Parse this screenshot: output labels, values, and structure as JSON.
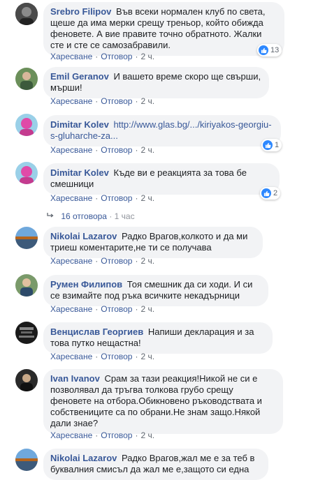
{
  "comments": [
    {
      "author": "Srebro Filipov",
      "text": "Във всеки нормален клуб по света, щеше да има мерки срещу треньор, който обижда феновете. А вие правите точно обратното. Жалки сте и сте се самозабравили.",
      "like_label": "Харесване",
      "reply_label": "Отговор",
      "time": "2 ч.",
      "reactions": "13"
    },
    {
      "author": "Emil Geranov",
      "text": "И вашето време скоро ще свърши, мърши!",
      "like_label": "Харесване",
      "reply_label": "Отговор",
      "time": "2 ч."
    },
    {
      "author": "Dimitar Kolev",
      "text": "http://www.glas.bg/.../kiriyakos-georgiu-s-gluharche-za...",
      "like_label": "Харесване",
      "reply_label": "Отговор",
      "time": "2 ч.",
      "reactions": "1"
    },
    {
      "author": "Dimitar Kolev",
      "text": "Къде ви е реакцията за това бе смешници",
      "like_label": "Харесване",
      "reply_label": "Отговор",
      "time": "2 ч.",
      "reactions": "2"
    },
    {
      "author": "Nikolai Lazarov",
      "text": "Радко Врагов,колкото и да ми триеш коментарите,не ти се получава",
      "like_label": "Харесване",
      "reply_label": "Отговор",
      "time": "2 ч."
    },
    {
      "author": "Румен Филипов",
      "text": "Тоя смешник да си ходи. И си се взимайте под ръка всичките некадърници",
      "like_label": "Харесване",
      "reply_label": "Отговор",
      "time": "2 ч."
    },
    {
      "author": "Венциcлав Георгиев",
      "text": "Напиши декларация и за това путко нещастна!",
      "like_label": "Харесване",
      "reply_label": "Отговор",
      "time": "2 ч."
    },
    {
      "author": "Ivan Ivanov",
      "text": "Срам за тази реакция!Никой не си е позволявал да тръгва толкова грубо срещу феновете на отбора.Обикновено ръководствата и собствениците са по обрани.Не знам защо.Някой дали знае?",
      "like_label": "Харесване",
      "reply_label": "Отговор",
      "time": "2 ч."
    },
    {
      "author": "Nikolai Lazarov",
      "text": "Радко Врагов,жал ме е за теб в буквалния смисъл да жал ме е,защото си една"
    }
  ],
  "replies_link": {
    "label": "16 отговора",
    "time": "1 час"
  },
  "colors": {
    "link": "#385898",
    "bubble": "#f2f3f5",
    "meta": "#606770",
    "like": "#2d88ff"
  },
  "icons": {
    "like": "thumbs-up-icon",
    "reply_arrow": "reply-arrow-icon"
  }
}
